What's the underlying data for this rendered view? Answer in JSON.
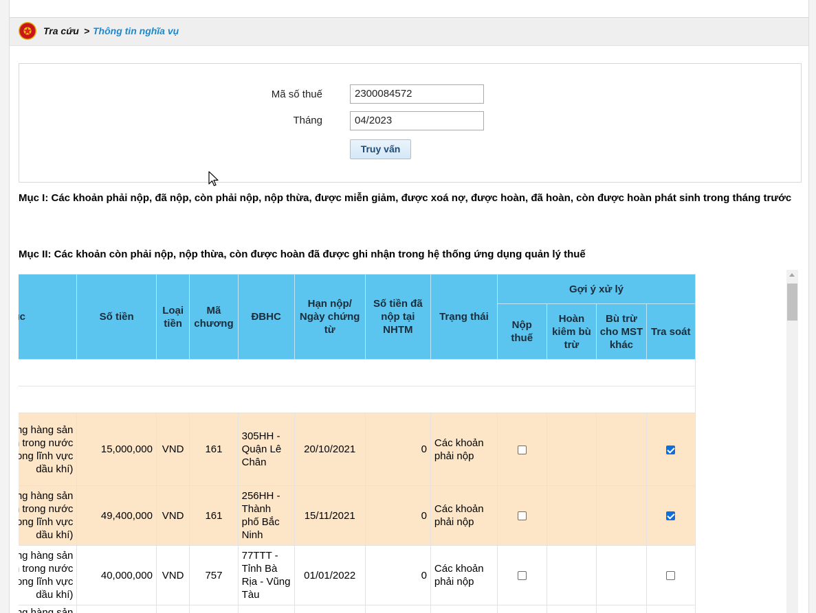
{
  "breadcrumb": {
    "root": "Tra cứu",
    "separator": ">",
    "current": "Thông tin nghĩa vụ"
  },
  "form": {
    "tax_code_label": "Mã số thuế",
    "tax_code_value": "2300084572",
    "month_label": "Tháng",
    "month_value": "04/2023",
    "submit_label": "Truy vấn"
  },
  "sections": {
    "section1": "Mục I: Các khoản phải nộp, đã nộp, còn phải nộp, nộp thừa, được miễn giảm, được xoá nợ, được hoàn, đã hoàn, còn được hoàn phát sinh trong tháng trước",
    "section2": "Mục II: Các khoản còn phải nộp, nộp thừa, còn được hoàn đã được ghi nhận trong hệ thống ứng dụng quản lý thuế"
  },
  "table": {
    "headers": {
      "tieu_muc": "Tiểu mục",
      "so_tien": "Số tiền",
      "loai_tien": "Loại tiền",
      "ma_chuong": "Mã chương",
      "dbhc": "ĐBHC",
      "han_nop": "Hạn nộp/ Ngày chứng từ",
      "so_tien_da_nop": "Số tiền đã nộp tại NHTM",
      "trang_thai": "Trạng thái",
      "goi_y": "Gợi ý xử lý",
      "nop_thue": "Nộp thuế",
      "hoan_kiem": "Hoàn kiêm bù trừ",
      "bu_tru": "Bù trừ cho MST khác",
      "tra_soat": "Tra soát"
    },
    "rows": [
      {
        "tieu_muc": "Thuế giá trị gia tăng hàng sản xuất, kinh doanh trong nước (gồm cả dịch vụ trong lĩnh vực dầu khí)",
        "so_tien": "15,000,000",
        "loai_tien": "VND",
        "ma_chuong": "161",
        "dbhc": "305HH - Quận Lê Chân",
        "han_nop": "20/10/2021",
        "so_tien_da_nop": "0",
        "trang_thai": "Các khoản phải nộp",
        "nop_thue_checked": false,
        "tra_soat_checked": true,
        "highlight": true
      },
      {
        "tieu_muc": "Thuế giá trị gia tăng hàng sản xuất, kinh doanh trong nước (gồm cả dịch vụ trong lĩnh vực dầu khí)",
        "so_tien": "49,400,000",
        "loai_tien": "VND",
        "ma_chuong": "161",
        "dbhc": "256HH - Thành phố Bắc Ninh",
        "han_nop": "15/11/2021",
        "so_tien_da_nop": "0",
        "trang_thai": "Các khoản phải nộp",
        "nop_thue_checked": false,
        "tra_soat_checked": true,
        "highlight": true
      },
      {
        "tieu_muc": "Thuế giá trị gia tăng hàng sản xuất, kinh doanh trong nước (gồm cả dịch vụ trong lĩnh vực dầu khí)",
        "so_tien": "40,000,000",
        "loai_tien": "VND",
        "ma_chuong": "757",
        "dbhc": "77TTT - Tỉnh Bà Rịa - Vũng Tàu",
        "han_nop": "01/01/2022",
        "so_tien_da_nop": "0",
        "trang_thai": "Các khoản phải nộp",
        "nop_thue_checked": false,
        "tra_soat_checked": false,
        "highlight": false
      },
      {
        "tieu_muc": "Thuế giá trị gia tăng hàng sản xuất, kinh doanh trong nước",
        "so_tien": "",
        "loai_tien": "",
        "ma_chuong": "",
        "dbhc": "",
        "han_nop": "",
        "so_tien_da_nop": "",
        "trang_thai": "",
        "nop_thue_checked": false,
        "tra_soat_checked": false,
        "highlight": false
      }
    ]
  },
  "icons": {
    "emblem": "national-emblem-icon",
    "cursor": "mouse-cursor-icon",
    "scroll_up": "scroll-up-arrow-icon"
  },
  "colors": {
    "header_bg": "#5bc5ef",
    "highlight_row": "#fde6c8",
    "breadcrumb_link": "#1a8ad0",
    "checkbox_checked": "#0b6fe0"
  }
}
